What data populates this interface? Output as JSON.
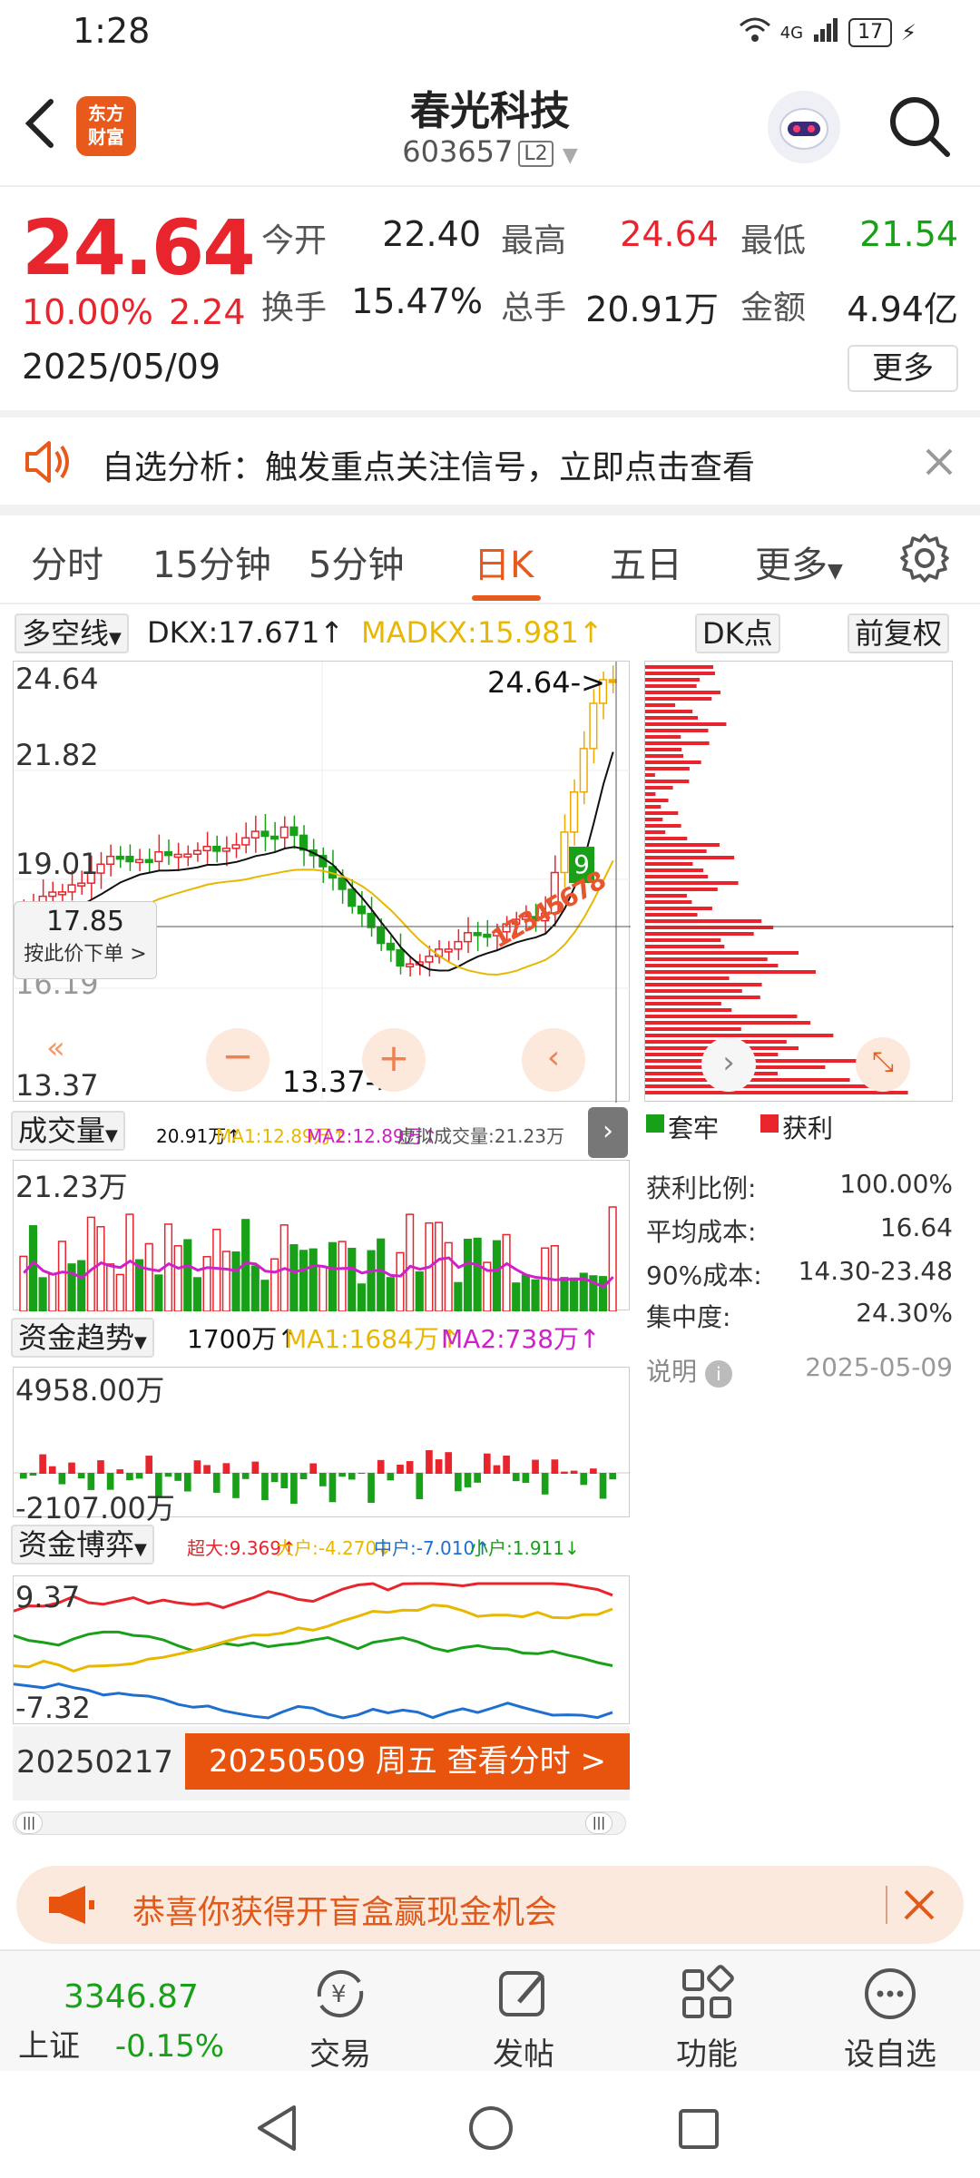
{
  "status": {
    "time": "1:28",
    "network": "4G",
    "battery": "17"
  },
  "header": {
    "logo_line1": "东方",
    "logo_line2": "财富",
    "stock_name": "春光科技",
    "stock_code": "603657",
    "level": "L2"
  },
  "quote": {
    "price": "24.64",
    "change_pct": "10.00%",
    "change": "2.24",
    "date": "2025/05/09",
    "fields": [
      {
        "label": "今开",
        "value": "22.40"
      },
      {
        "label": "最高",
        "value": "24.64"
      },
      {
        "label": "最低",
        "value": "21.54"
      },
      {
        "label": "换手",
        "value": "15.47%"
      },
      {
        "label": "总手",
        "value": "20.91万"
      },
      {
        "label": "金额",
        "value": "4.94亿"
      }
    ],
    "more": "更多"
  },
  "alert": {
    "text": "自选分析：触发重点关注信号，立即点击查看"
  },
  "tabs": [
    "分时",
    "15分钟",
    "5分钟",
    "日K",
    "五日",
    "更多"
  ],
  "active_tab": "日K",
  "indicator1": {
    "name": "多空线",
    "dkx": "DKX:17.671↑",
    "madkx": "MADKX:15.981↑",
    "dk_btn": "DK点",
    "fq_btn": "前复权"
  },
  "kchart": {
    "y_labels": [
      "24.64",
      "21.82",
      "19.01",
      "16.19",
      "13.37"
    ],
    "max_label": "24.64->",
    "min_label": "13.37->",
    "crosshair_price": "17.85",
    "crosshair_hint": "按此价下单 >",
    "signal_9": "9",
    "signal_seq": "1 2 3 4 5 6 7 8"
  },
  "volume": {
    "name": "成交量",
    "info": "20.91万↑",
    "ma1": "MA1:12.89万↑",
    "ma2": "MA2:12.89万↑",
    "virtual": "虚拟成交量:21.23万",
    "y_top": "21.23万"
  },
  "fund_trend": {
    "name": "资金趋势",
    "value": "1700万↑",
    "ma1": "MA1:1684万↑",
    "ma2": "MA2:738万↑",
    "y_top": "4958.00万",
    "y_bottom": "-2107.00万"
  },
  "fund_game": {
    "name": "资金博弈",
    "super": "超大:9.369↑",
    "big": "大户:-4.270↓",
    "mid": "中户:-7.010↑",
    "small": "小户:1.911↓",
    "y_top": "9.37",
    "y_bottom": "-7.32"
  },
  "date_bar": {
    "start": "20250217",
    "selected": "20250509 周五 查看分时 >"
  },
  "chip_panel": {
    "legend_trapped": "套牢",
    "legend_profit": "获利",
    "rows": [
      {
        "label": "获利比例:",
        "value": "100.00%"
      },
      {
        "label": "平均成本:",
        "value": "16.64"
      },
      {
        "label": "90%成本:",
        "value": "14.30-23.48"
      },
      {
        "label": "集中度:",
        "value": "24.30%"
      }
    ],
    "note": "说明",
    "note_date": "2025-05-09"
  },
  "banner": {
    "text": "恭喜你获得开盲盒赢现金机会"
  },
  "bottom_nav": {
    "index_value": "3346.87",
    "index_name": "上证",
    "index_change": "-0.15%",
    "items": [
      "交易",
      "发帖",
      "功能",
      "设自选"
    ]
  },
  "colors": {
    "up": "#e8242c",
    "down": "#19a019",
    "accent": "#e85a1c",
    "ma_yellow": "#e8b800",
    "ma_purple": "#d020c8"
  }
}
